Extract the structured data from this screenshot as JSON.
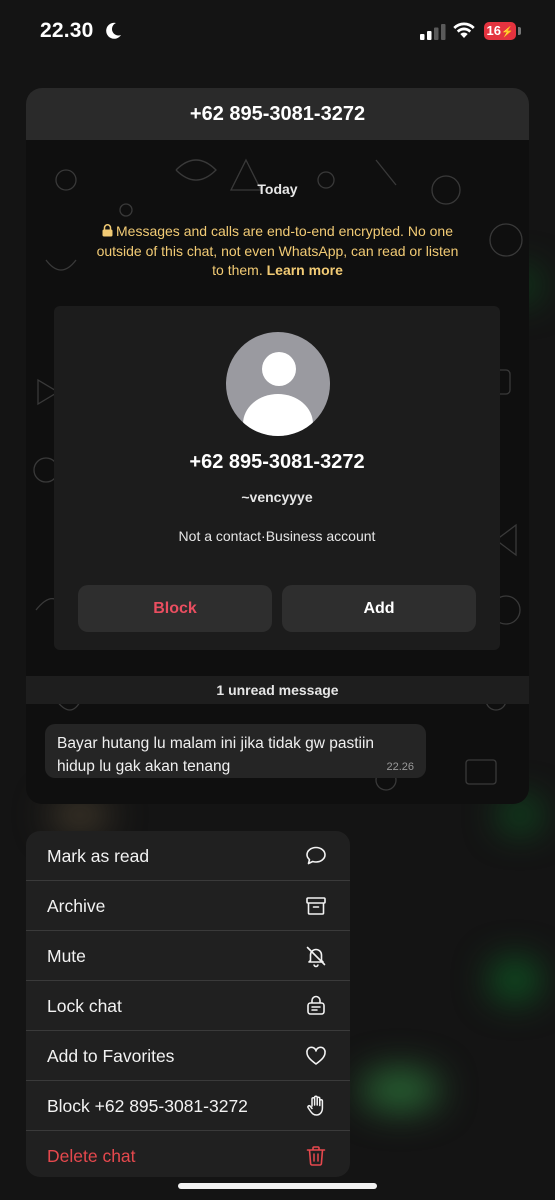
{
  "status_bar": {
    "time": "22.30",
    "battery": "16"
  },
  "chat": {
    "title": "+62 895-3081-3272",
    "date_label": "Today",
    "encryption_notice": "Messages and calls are end-to-end encrypted. No one outside of this chat, not even WhatsApp, can read or listen to them.",
    "learn_more": "Learn more",
    "profile": {
      "number": "+62 895-3081-3272",
      "username": "~vencyyye",
      "meta": "Not a contact·Business account",
      "block_label": "Block",
      "add_label": "Add"
    },
    "unread_label": "1 unread message",
    "message": {
      "text": "Bayar hutang lu malam ini jika tidak gw pastiin hidup lu gak akan tenang",
      "time": "22.26"
    }
  },
  "menu": {
    "items": [
      {
        "label": "Mark as read",
        "icon": "chat-bubble-icon"
      },
      {
        "label": "Archive",
        "icon": "archive-box-icon"
      },
      {
        "label": "Mute",
        "icon": "bell-slash-icon"
      },
      {
        "label": "Lock chat",
        "icon": "chat-lock-icon"
      },
      {
        "label": "Add to Favorites",
        "icon": "heart-icon"
      },
      {
        "label": "Block +62 895-3081-3272",
        "icon": "hand-raised-icon"
      },
      {
        "label": "Delete chat",
        "icon": "trash-icon"
      }
    ]
  },
  "colors": {
    "danger": "#e5484d",
    "encryption_text": "#f2cb75",
    "battery": "#e4333f"
  }
}
